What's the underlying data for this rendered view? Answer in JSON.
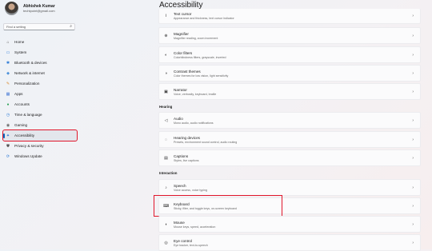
{
  "profile": {
    "name": "Abhishek Kumar",
    "email": "techtpoint@gmail.com"
  },
  "search": {
    "placeholder": "Find a setting",
    "icon": "search-icon"
  },
  "sidebar": {
    "items": [
      {
        "label": "Home",
        "icon": "home-icon",
        "glyph": "⌂",
        "color": "#555555"
      },
      {
        "label": "System",
        "icon": "system-icon",
        "glyph": "▭",
        "color": "#2d7bd6"
      },
      {
        "label": "Bluetooth & devices",
        "icon": "bluetooth-icon",
        "glyph": "✱",
        "color": "#2d7bd6"
      },
      {
        "label": "Network & internet",
        "icon": "network-icon",
        "glyph": "◆",
        "color": "#4a90d9"
      },
      {
        "label": "Personalization",
        "icon": "brush-icon",
        "glyph": "✎",
        "color": "#d98a2d"
      },
      {
        "label": "Apps",
        "icon": "apps-icon",
        "glyph": "▦",
        "color": "#4a7bd6"
      },
      {
        "label": "Accounts",
        "icon": "account-icon",
        "glyph": "●",
        "color": "#2fa35a"
      },
      {
        "label": "Time & language",
        "icon": "clock-icon",
        "glyph": "◷",
        "color": "#2d7bd6"
      },
      {
        "label": "Gaming",
        "icon": "gamepad-icon",
        "glyph": "◉",
        "color": "#666666"
      },
      {
        "label": "Accessibility",
        "icon": "accessibility-icon",
        "glyph": "✦",
        "color": "#1f6fd0",
        "active": true
      },
      {
        "label": "Privacy & security",
        "icon": "shield-icon",
        "glyph": "⛊",
        "color": "#555555"
      },
      {
        "label": "Windows Update",
        "icon": "update-icon",
        "glyph": "⟳",
        "color": "#2d7bd6"
      }
    ]
  },
  "main": {
    "title": "Accessibility",
    "top_cards": [
      {
        "title": "Text cursor",
        "desc": "Appearance and thickness, text cursor indicator",
        "icon": "text-cursor-icon",
        "glyph": "Ⅰ"
      },
      {
        "title": "Magnifier",
        "desc": "Magnifier reading, zoom increment",
        "icon": "magnifier-icon",
        "glyph": "⊕"
      },
      {
        "title": "Color filters",
        "desc": "Colorblindness filters, grayscale, inverted",
        "icon": "color-filter-icon",
        "glyph": "◐"
      },
      {
        "title": "Contrast themes",
        "desc": "Color themes for low vision, light sensitivity",
        "icon": "contrast-icon",
        "glyph": "◑"
      },
      {
        "title": "Narrator",
        "desc": "Voice, verbosity, keyboard, braille",
        "icon": "narrator-icon",
        "glyph": "▣"
      }
    ],
    "hearing_label": "Hearing",
    "hearing_cards": [
      {
        "title": "Audio",
        "desc": "Mono audio, audio notifications",
        "icon": "speaker-icon",
        "glyph": "◁"
      },
      {
        "title": "Hearing devices",
        "desc": "Presets, environment sound control, audio routing",
        "icon": "hearing-device-icon",
        "glyph": "◌"
      },
      {
        "title": "Captions",
        "desc": "Styles, live captions",
        "icon": "captions-icon",
        "glyph": "▤"
      }
    ],
    "interaction_label": "Interaction",
    "interaction_cards": [
      {
        "title": "Speech",
        "desc": "Voice access, voice typing",
        "icon": "microphone-icon",
        "glyph": "♪"
      },
      {
        "title": "Keyboard",
        "desc": "Sticky, filter, and toggle keys, on-screen keyboard",
        "icon": "keyboard-icon",
        "glyph": "⌨"
      },
      {
        "title": "Mouse",
        "desc": "Mouse keys, speed, acceleration",
        "icon": "mouse-icon",
        "glyph": "◖"
      },
      {
        "title": "Eye control",
        "desc": "Eye tracker, text-to-speech",
        "icon": "eye-icon",
        "glyph": "◎"
      }
    ],
    "chevron": "›"
  },
  "colors": {
    "highlight": "#e0162b",
    "accent": "#0067c0"
  }
}
